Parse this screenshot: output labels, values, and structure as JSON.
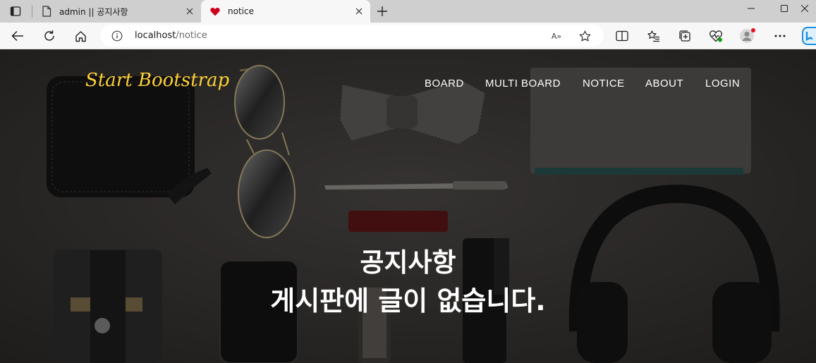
{
  "browser": {
    "tabs": [
      {
        "title": "admin || 공지사항",
        "active": false,
        "favicon": "page-icon"
      },
      {
        "title": "notice",
        "active": true,
        "favicon": "heart-icon"
      }
    ],
    "address": {
      "host": "localhost",
      "path": "/notice"
    },
    "read_aloud_label": "A»"
  },
  "site": {
    "brand": "Start Bootstrap",
    "nav": [
      "BOARD",
      "MULTI BOARD",
      "NOTICE",
      "ABOUT",
      "LOGIN"
    ]
  },
  "hero": {
    "title": "공지사항",
    "message": "게시판에 글이 없습니다."
  },
  "colors": {
    "brand": "#fed136",
    "heart": "#d0021b",
    "profile_dot": "#e81123",
    "tracker_dot": "#13a10e",
    "copilot": "#1b8fe0"
  }
}
